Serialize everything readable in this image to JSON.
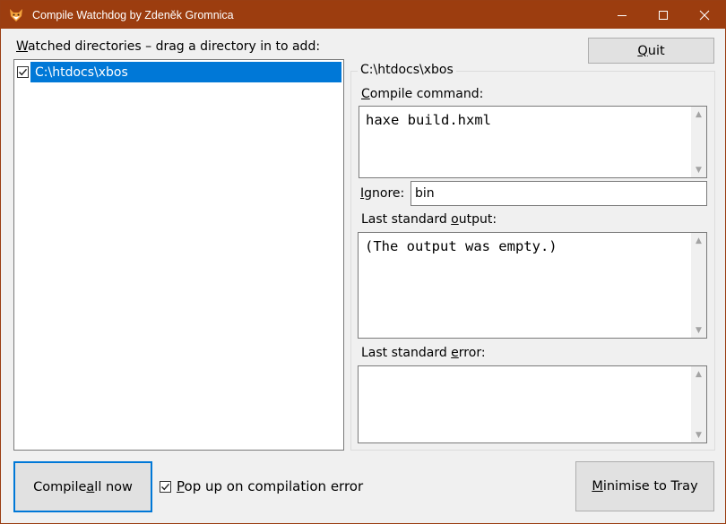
{
  "window": {
    "title": "Compile Watchdog by Zdeněk Gromnica",
    "minimize_icon": "minimize-icon",
    "maximize_icon": "maximize-icon",
    "close_icon": "close-icon",
    "app_icon": "fox-icon"
  },
  "watched": {
    "label_first": "W",
    "label_rest": "atched directories – drag a directory in to add:",
    "items": [
      {
        "path": "C:\\htdocs\\xbos",
        "checked": true,
        "selected": true
      }
    ]
  },
  "quit_button": {
    "mn": "Q",
    "rest": "uit"
  },
  "detail": {
    "group_title": "C:\\htdocs\\xbos",
    "compile_command": {
      "label_mn": "C",
      "label_rest": "ompile command:",
      "value": "haxe build.hxml"
    },
    "ignore": {
      "label_mn": "I",
      "label_rest": "gnore:",
      "value": "bin"
    },
    "stdout": {
      "label_pre": "Last standard ",
      "label_mn": "o",
      "label_post": "utput:",
      "value": "(The output was empty.)"
    },
    "stderr": {
      "label_pre": "Last standard ",
      "label_mn": "e",
      "label_post": "rror:",
      "value": ""
    }
  },
  "bottom": {
    "compile_all": {
      "pre": "Compile ",
      "mn": "a",
      "post": "ll now"
    },
    "popup_checkbox": {
      "mn": "P",
      "rest": "op up on compilation error",
      "checked": true
    },
    "minimise": {
      "mn": "M",
      "rest": "inimise to Tray"
    }
  },
  "colors": {
    "titlebar": "#9c3d0f",
    "selection": "#0078d7",
    "button_face": "#e1e1e1"
  }
}
